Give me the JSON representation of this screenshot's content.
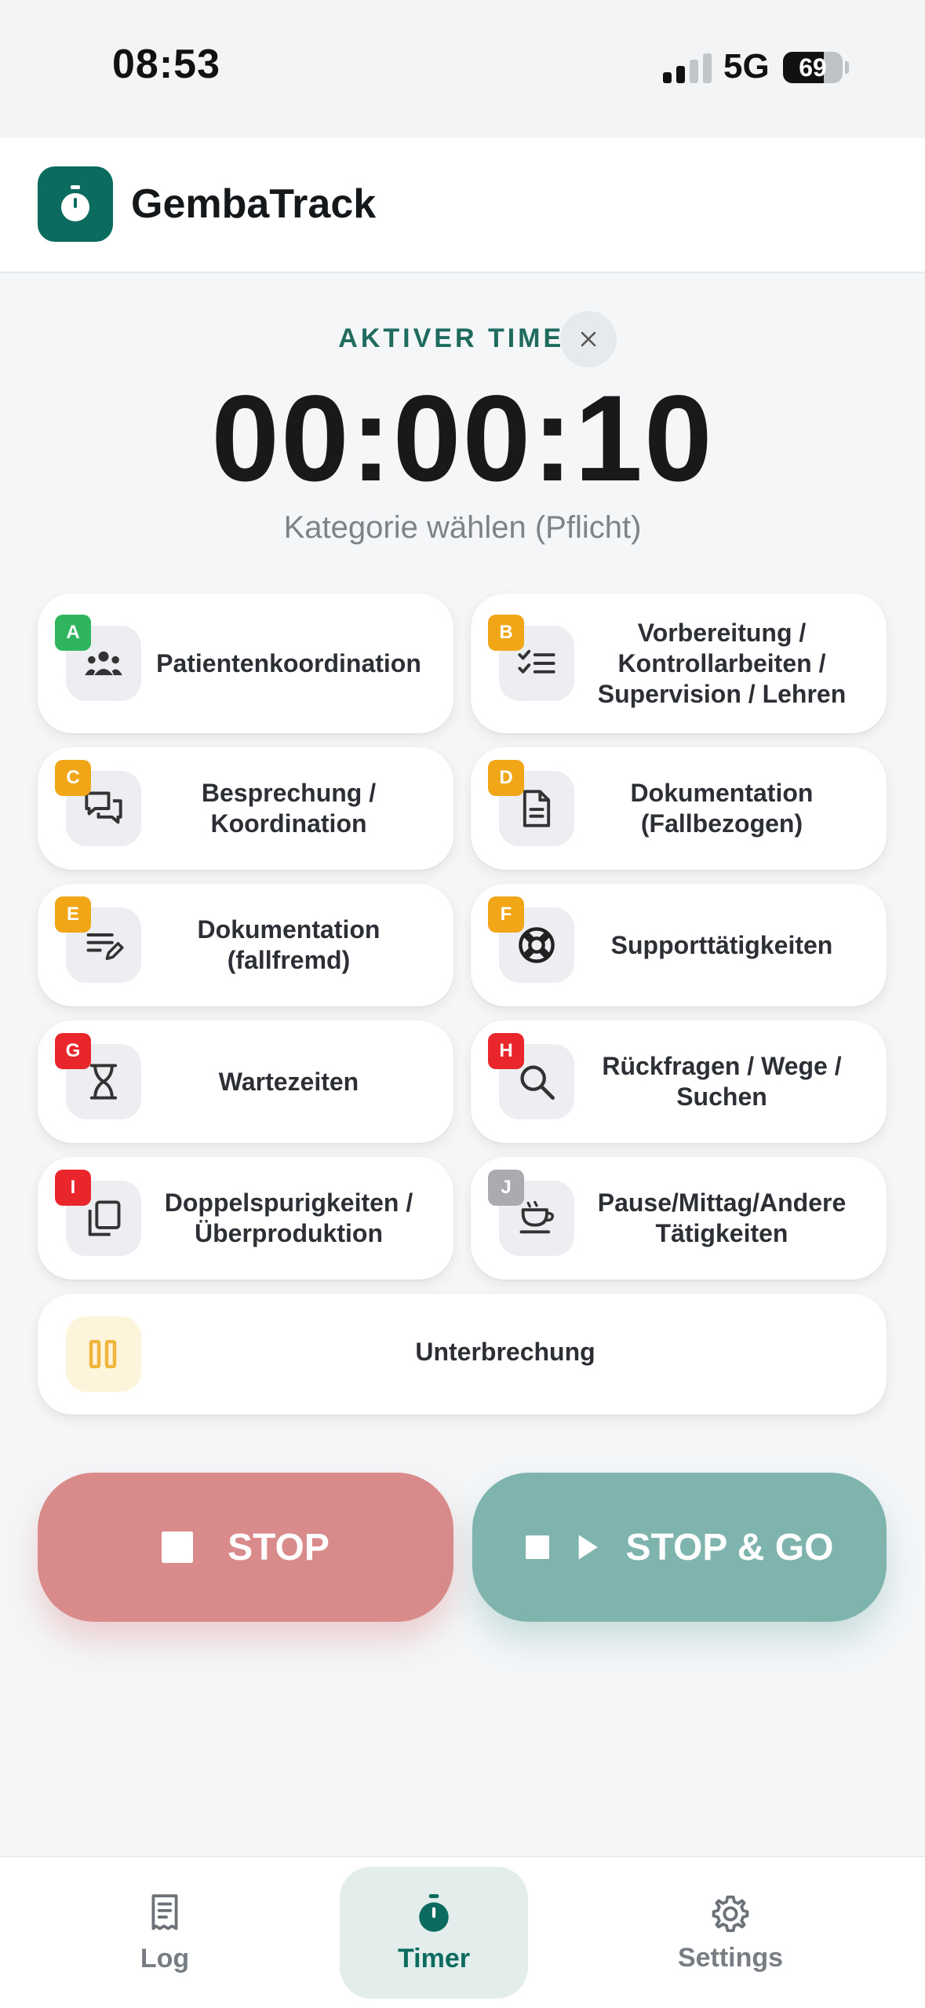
{
  "status_bar": {
    "time": "08:53",
    "network": "5G",
    "battery": "69",
    "battery_level": 0.69
  },
  "app": {
    "name": "GembaTrack",
    "icon": "stopwatch-icon"
  },
  "timer": {
    "label": "AKTIVER TIMER",
    "value": "00:00:10",
    "hint": "Kategorie wählen (Pflicht)"
  },
  "categories": [
    {
      "code": "A",
      "label_lines": [
        "Patientenkoordination"
      ],
      "badge_color": "#2fb55d",
      "icon": "group-icon"
    },
    {
      "code": "B",
      "label_lines": [
        "Vorbereitung /",
        "Kontrollarbeiten /",
        "Supervision / Lehren"
      ],
      "badge_color": "#f0a617",
      "icon": "checklist-icon"
    },
    {
      "code": "C",
      "label_lines": [
        "Besprechung /",
        "Koordination"
      ],
      "badge_color": "#f0a617",
      "icon": "chat-icon"
    },
    {
      "code": "D",
      "label_lines": [
        "Dokumentation",
        "(Fallbezogen)"
      ],
      "badge_color": "#f0a617",
      "icon": "document-icon"
    },
    {
      "code": "E",
      "label_lines": [
        "Dokumentation",
        "(fallfremd)"
      ],
      "badge_color": "#f0a617",
      "icon": "edit-list-icon"
    },
    {
      "code": "F",
      "label_lines": [
        "Supporttätigkeiten"
      ],
      "badge_color": "#f0a617",
      "icon": "lifebuoy-icon"
    },
    {
      "code": "G",
      "label_lines": [
        "Wartezeiten"
      ],
      "badge_color": "#e8262b",
      "icon": "hourglass-icon"
    },
    {
      "code": "H",
      "label_lines": [
        "Rückfragen / Wege /",
        "Suchen"
      ],
      "badge_color": "#e8262b",
      "icon": "search-icon"
    },
    {
      "code": "I",
      "label_lines": [
        "Doppelspurigkeiten /",
        "Überproduktion"
      ],
      "badge_color": "#e8262b",
      "icon": "copy-icon"
    },
    {
      "code": "J",
      "label_lines": [
        "Pause/Mittag/Andere",
        "Tätigkeiten"
      ],
      "badge_color": "#a9abae",
      "icon": "coffee-icon"
    }
  ],
  "interruption": {
    "label": "Unterbrechung",
    "icon": "pause-icon",
    "color": "#f0b53a"
  },
  "actions": {
    "stop_label": "STOP",
    "stop_go_label": "STOP & GO",
    "stop_color": "#d98a8a",
    "go_color": "#7fb3ad"
  },
  "nav": [
    {
      "label": "Log",
      "icon": "receipt-icon",
      "active": false
    },
    {
      "label": "Timer",
      "icon": "stopwatch-icon",
      "active": true
    },
    {
      "label": "Settings",
      "icon": "gear-icon",
      "active": false
    }
  ],
  "accent_color": "#0b6b5f"
}
